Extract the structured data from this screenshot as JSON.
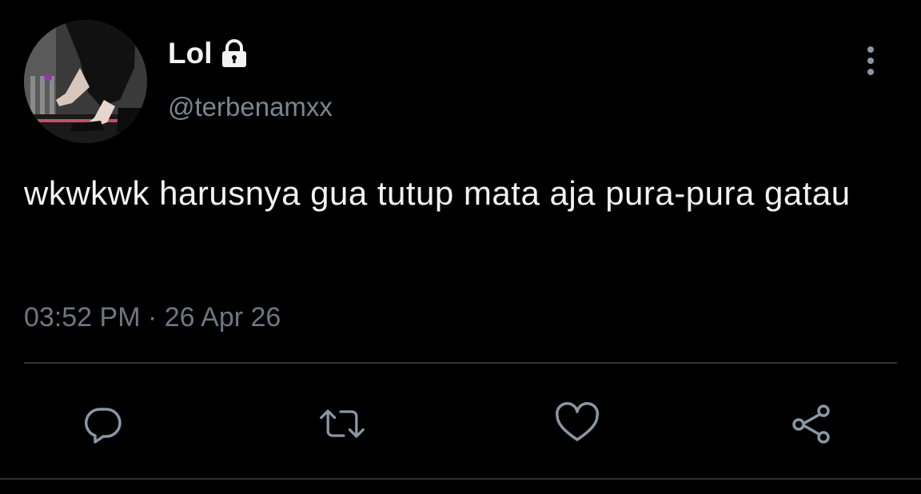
{
  "user": {
    "display_name": "Lol",
    "handle": "@terbenamxx",
    "protected_icon": "lock-icon",
    "avatar_icon": "profile-photo"
  },
  "tweet": {
    "text": "wkwkwk harusnya gua tutup mata aja pura-pura gatau",
    "time": "03:52 PM",
    "separator": "·",
    "date": "26 Apr 26"
  },
  "menu": {
    "icon": "more-vertical-icon"
  },
  "actions": [
    {
      "name": "reply",
      "icon": "reply-icon"
    },
    {
      "name": "retweet",
      "icon": "retweet-icon"
    },
    {
      "name": "like",
      "icon": "heart-icon"
    },
    {
      "name": "share",
      "icon": "share-icon"
    }
  ],
  "colors": {
    "background": "#000000",
    "primary_text": "#f2f2f2",
    "secondary_text": "#7b8691",
    "icon": "#8a96a3",
    "divider": "#2f3336"
  }
}
